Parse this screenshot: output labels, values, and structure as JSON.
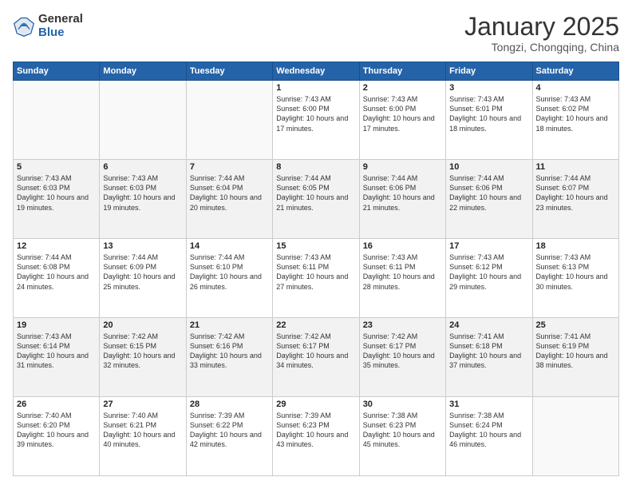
{
  "logo": {
    "general": "General",
    "blue": "Blue"
  },
  "title": "January 2025",
  "location": "Tongzi, Chongqing, China",
  "days_header": [
    "Sunday",
    "Monday",
    "Tuesday",
    "Wednesday",
    "Thursday",
    "Friday",
    "Saturday"
  ],
  "weeks": [
    {
      "shaded": false,
      "cells": [
        {
          "day": "",
          "content": ""
        },
        {
          "day": "",
          "content": ""
        },
        {
          "day": "",
          "content": ""
        },
        {
          "day": "1",
          "content": "Sunrise: 7:43 AM\nSunset: 6:00 PM\nDaylight: 10 hours and 17 minutes."
        },
        {
          "day": "2",
          "content": "Sunrise: 7:43 AM\nSunset: 6:00 PM\nDaylight: 10 hours and 17 minutes."
        },
        {
          "day": "3",
          "content": "Sunrise: 7:43 AM\nSunset: 6:01 PM\nDaylight: 10 hours and 18 minutes."
        },
        {
          "day": "4",
          "content": "Sunrise: 7:43 AM\nSunset: 6:02 PM\nDaylight: 10 hours and 18 minutes."
        }
      ]
    },
    {
      "shaded": true,
      "cells": [
        {
          "day": "5",
          "content": "Sunrise: 7:43 AM\nSunset: 6:03 PM\nDaylight: 10 hours and 19 minutes."
        },
        {
          "day": "6",
          "content": "Sunrise: 7:43 AM\nSunset: 6:03 PM\nDaylight: 10 hours and 19 minutes."
        },
        {
          "day": "7",
          "content": "Sunrise: 7:44 AM\nSunset: 6:04 PM\nDaylight: 10 hours and 20 minutes."
        },
        {
          "day": "8",
          "content": "Sunrise: 7:44 AM\nSunset: 6:05 PM\nDaylight: 10 hours and 21 minutes."
        },
        {
          "day": "9",
          "content": "Sunrise: 7:44 AM\nSunset: 6:06 PM\nDaylight: 10 hours and 21 minutes."
        },
        {
          "day": "10",
          "content": "Sunrise: 7:44 AM\nSunset: 6:06 PM\nDaylight: 10 hours and 22 minutes."
        },
        {
          "day": "11",
          "content": "Sunrise: 7:44 AM\nSunset: 6:07 PM\nDaylight: 10 hours and 23 minutes."
        }
      ]
    },
    {
      "shaded": false,
      "cells": [
        {
          "day": "12",
          "content": "Sunrise: 7:44 AM\nSunset: 6:08 PM\nDaylight: 10 hours and 24 minutes."
        },
        {
          "day": "13",
          "content": "Sunrise: 7:44 AM\nSunset: 6:09 PM\nDaylight: 10 hours and 25 minutes."
        },
        {
          "day": "14",
          "content": "Sunrise: 7:44 AM\nSunset: 6:10 PM\nDaylight: 10 hours and 26 minutes."
        },
        {
          "day": "15",
          "content": "Sunrise: 7:43 AM\nSunset: 6:11 PM\nDaylight: 10 hours and 27 minutes."
        },
        {
          "day": "16",
          "content": "Sunrise: 7:43 AM\nSunset: 6:11 PM\nDaylight: 10 hours and 28 minutes."
        },
        {
          "day": "17",
          "content": "Sunrise: 7:43 AM\nSunset: 6:12 PM\nDaylight: 10 hours and 29 minutes."
        },
        {
          "day": "18",
          "content": "Sunrise: 7:43 AM\nSunset: 6:13 PM\nDaylight: 10 hours and 30 minutes."
        }
      ]
    },
    {
      "shaded": true,
      "cells": [
        {
          "day": "19",
          "content": "Sunrise: 7:43 AM\nSunset: 6:14 PM\nDaylight: 10 hours and 31 minutes."
        },
        {
          "day": "20",
          "content": "Sunrise: 7:42 AM\nSunset: 6:15 PM\nDaylight: 10 hours and 32 minutes."
        },
        {
          "day": "21",
          "content": "Sunrise: 7:42 AM\nSunset: 6:16 PM\nDaylight: 10 hours and 33 minutes."
        },
        {
          "day": "22",
          "content": "Sunrise: 7:42 AM\nSunset: 6:17 PM\nDaylight: 10 hours and 34 minutes."
        },
        {
          "day": "23",
          "content": "Sunrise: 7:42 AM\nSunset: 6:17 PM\nDaylight: 10 hours and 35 minutes."
        },
        {
          "day": "24",
          "content": "Sunrise: 7:41 AM\nSunset: 6:18 PM\nDaylight: 10 hours and 37 minutes."
        },
        {
          "day": "25",
          "content": "Sunrise: 7:41 AM\nSunset: 6:19 PM\nDaylight: 10 hours and 38 minutes."
        }
      ]
    },
    {
      "shaded": false,
      "cells": [
        {
          "day": "26",
          "content": "Sunrise: 7:40 AM\nSunset: 6:20 PM\nDaylight: 10 hours and 39 minutes."
        },
        {
          "day": "27",
          "content": "Sunrise: 7:40 AM\nSunset: 6:21 PM\nDaylight: 10 hours and 40 minutes."
        },
        {
          "day": "28",
          "content": "Sunrise: 7:39 AM\nSunset: 6:22 PM\nDaylight: 10 hours and 42 minutes."
        },
        {
          "day": "29",
          "content": "Sunrise: 7:39 AM\nSunset: 6:23 PM\nDaylight: 10 hours and 43 minutes."
        },
        {
          "day": "30",
          "content": "Sunrise: 7:38 AM\nSunset: 6:23 PM\nDaylight: 10 hours and 45 minutes."
        },
        {
          "day": "31",
          "content": "Sunrise: 7:38 AM\nSunset: 6:24 PM\nDaylight: 10 hours and 46 minutes."
        },
        {
          "day": "",
          "content": ""
        }
      ]
    }
  ]
}
